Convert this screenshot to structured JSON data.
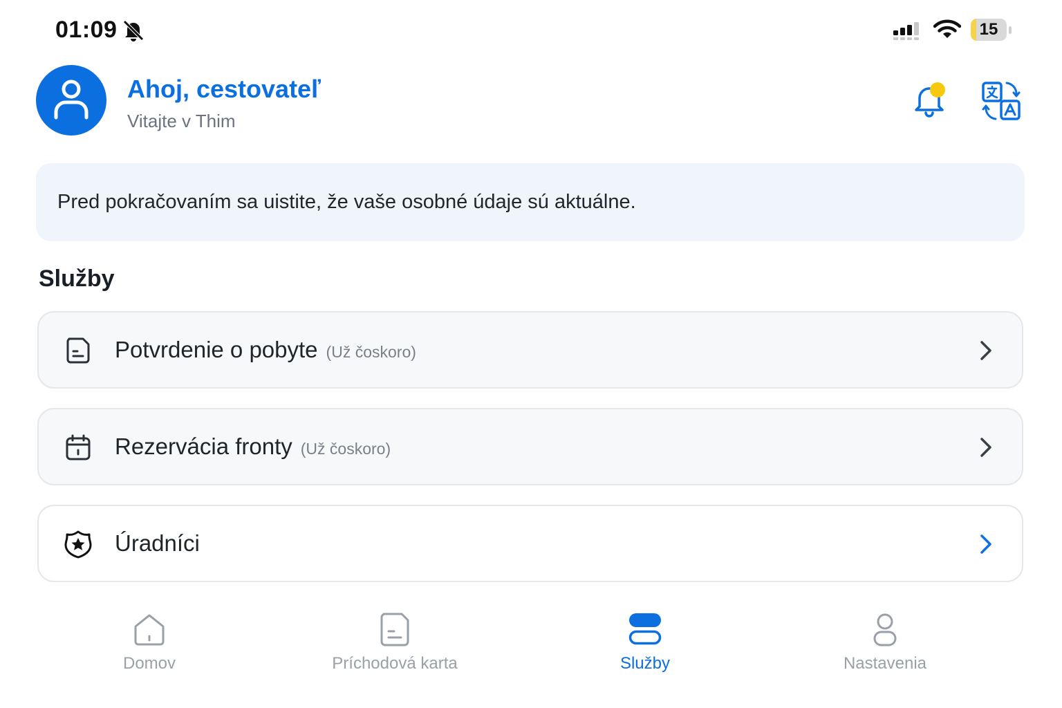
{
  "status_bar": {
    "time": "01:09",
    "battery": "15",
    "battery_level": 0.15
  },
  "header": {
    "greeting": "Ahoj, cestovateľ",
    "subtitle": "Vitajte v Thim"
  },
  "notice": {
    "text": "Pred pokračovaním sa uistite, že vaše osobné údaje sú aktuálne."
  },
  "services": {
    "title": "Služby",
    "items": [
      {
        "label": "Potvrdenie o pobyte",
        "note": "(Už čoskoro)",
        "icon": "document-icon"
      },
      {
        "label": "Rezervácia fronty",
        "note": "(Už čoskoro)",
        "icon": "calendar-icon"
      },
      {
        "label": "Úradníci",
        "note": "",
        "icon": "badge-star-icon"
      }
    ]
  },
  "nav": {
    "items": [
      {
        "label": "Domov",
        "icon": "home-icon"
      },
      {
        "label": "Príchodová karta",
        "icon": "document-icon"
      },
      {
        "label": "Služby",
        "icon": "services-icon",
        "active": true
      },
      {
        "label": "Nastavenia",
        "icon": "person-icon"
      }
    ]
  },
  "colors": {
    "accent": "#0b6fe0",
    "notification_dot": "#f6c90e",
    "notice_background": "#f0f5fc"
  }
}
